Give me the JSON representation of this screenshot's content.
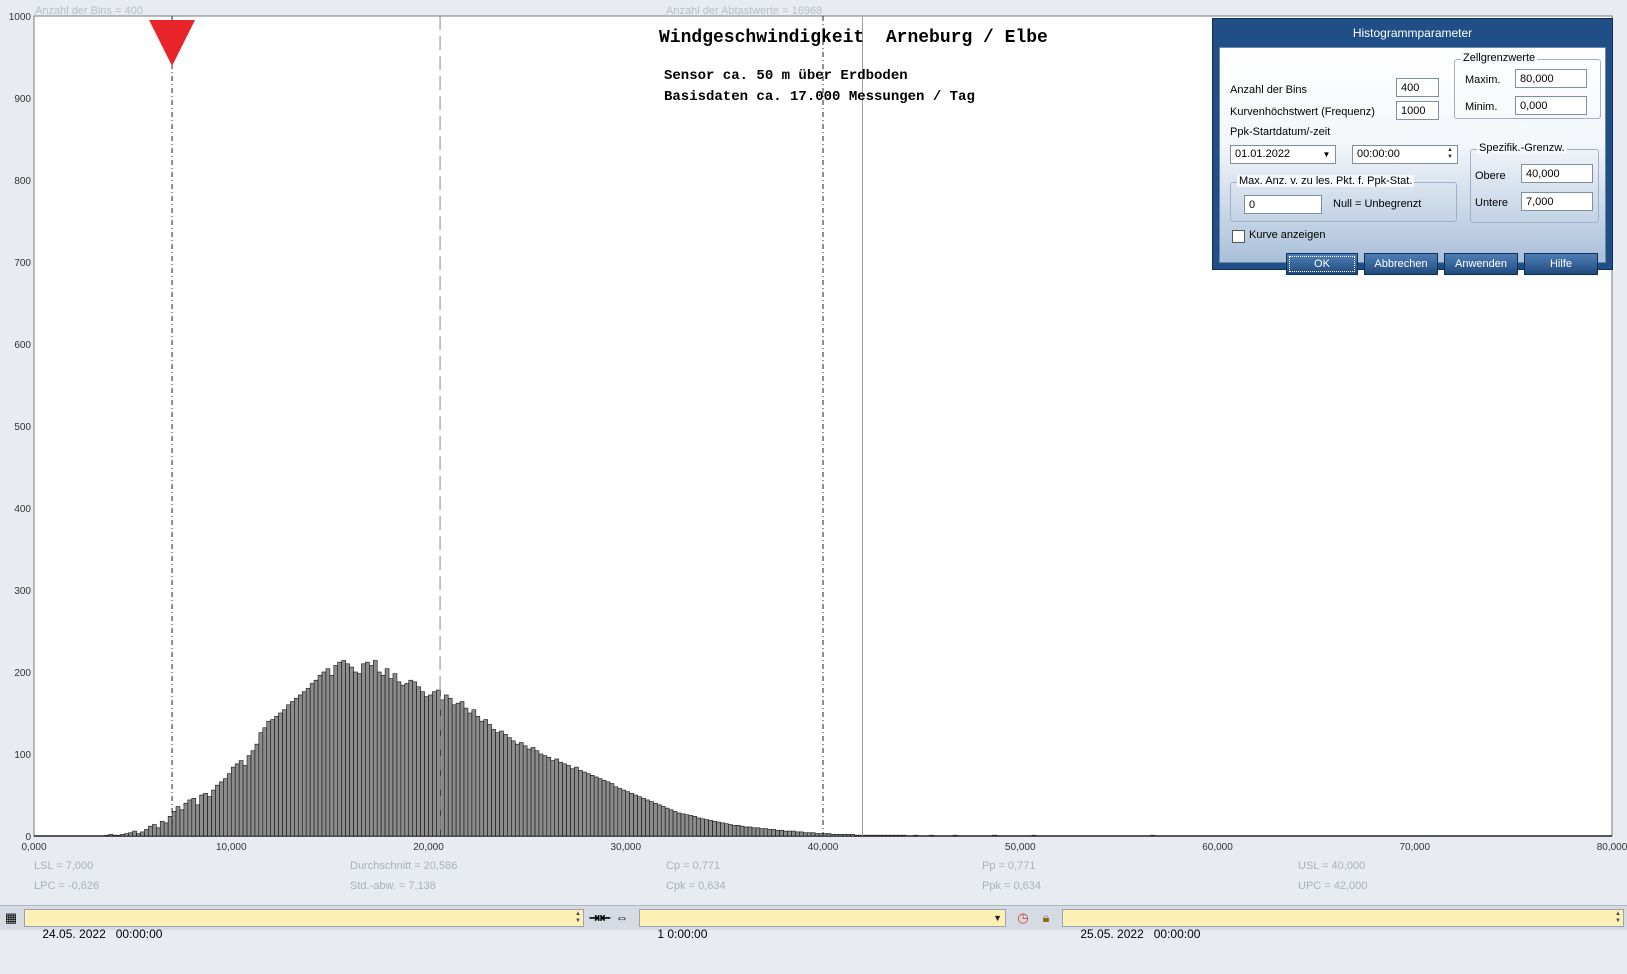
{
  "header": {
    "bins_text": "Anzahl der Bins =   400",
    "samples_text": "Anzahl der Abtastwerte = 16968"
  },
  "chart_titles": {
    "line1": "Windgeschwindigkeit  Arneburg / Elbe",
    "line2": "Sensor ca. 50 m über Erdboden",
    "line3": "Basisdaten ca. 17.000 Messungen / Tag"
  },
  "stats": {
    "lsl": "LSL = 7,000",
    "lpc": "LPC = -0,626",
    "mean": "Durchschnitt  = 20,586",
    "std": "Std.-abw. = 7,138",
    "cp": "Cp  = 0,771",
    "cpk": "Cpk = 0,634",
    "pp": "Pp  = 0,771",
    "ppk": "Ppk = 0,634",
    "usl": "USL = 40,000",
    "upc": "UPC = 42,000"
  },
  "chart_data": {
    "type": "bar",
    "xlim": [
      0,
      80
    ],
    "ylim": [
      0,
      1000
    ],
    "x_ticks": [
      {
        "v": 0,
        "label": "0,000"
      },
      {
        "v": 10,
        "label": "10,000"
      },
      {
        "v": 20,
        "label": "20,000"
      },
      {
        "v": 30,
        "label": "30,000"
      },
      {
        "v": 40,
        "label": "40,000"
      },
      {
        "v": 50,
        "label": "50,000"
      },
      {
        "v": 60,
        "label": "60,000"
      },
      {
        "v": 70,
        "label": "70,000"
      },
      {
        "v": 80,
        "label": "80,000"
      }
    ],
    "y_ticks": [
      {
        "v": 0,
        "label": "0"
      },
      {
        "v": 100,
        "label": "100"
      },
      {
        "v": 200,
        "label": "200"
      },
      {
        "v": 300,
        "label": "300"
      },
      {
        "v": 400,
        "label": "400"
      },
      {
        "v": 500,
        "label": "500"
      },
      {
        "v": 600,
        "label": "600"
      },
      {
        "v": 700,
        "label": "700"
      },
      {
        "v": 800,
        "label": "800"
      },
      {
        "v": 900,
        "label": "900"
      },
      {
        "v": 1000,
        "label": "1000"
      }
    ],
    "bin_width": 0.2,
    "bin_start": 0,
    "values": [
      0,
      0,
      0,
      0,
      0,
      0,
      0,
      0,
      0,
      0,
      0,
      0,
      0,
      0,
      0,
      0,
      0,
      0,
      1,
      2,
      1,
      1,
      2,
      3,
      4,
      6,
      3,
      5,
      8,
      12,
      14,
      10,
      18,
      16,
      24,
      30,
      36,
      32,
      40,
      44,
      46,
      38,
      50,
      52,
      48,
      56,
      62,
      66,
      70,
      76,
      84,
      88,
      92,
      86,
      98,
      104,
      112,
      126,
      132,
      140,
      142,
      146,
      150,
      154,
      160,
      164,
      168,
      172,
      176,
      180,
      186,
      190,
      196,
      200,
      204,
      196,
      208,
      212,
      214,
      210,
      206,
      200,
      198,
      210,
      212,
      208,
      214,
      200,
      196,
      204,
      192,
      198,
      188,
      184,
      186,
      190,
      188,
      182,
      176,
      170,
      172,
      176,
      178,
      166,
      172,
      168,
      160,
      162,
      164,
      156,
      150,
      154,
      146,
      140,
      142,
      136,
      130,
      126,
      128,
      124,
      120,
      116,
      112,
      114,
      110,
      106,
      108,
      104,
      100,
      98,
      96,
      92,
      94,
      90,
      88,
      86,
      82,
      84,
      80,
      78,
      76,
      74,
      72,
      70,
      68,
      66,
      64,
      60,
      58,
      56,
      54,
      52,
      50,
      48,
      46,
      44,
      42,
      40,
      38,
      36,
      34,
      32,
      30,
      28,
      27,
      26,
      25,
      24,
      22,
      21,
      20,
      19,
      18,
      17,
      16,
      15,
      14,
      13,
      13,
      12,
      11,
      11,
      10,
      10,
      9,
      9,
      8,
      8,
      7,
      7,
      6,
      6,
      6,
      5,
      5,
      4,
      4,
      4,
      3,
      3,
      3,
      3,
      2,
      2,
      2,
      2,
      2,
      2,
      1,
      1,
      1,
      1,
      1,
      1,
      1,
      1,
      1,
      1,
      1,
      1,
      1,
      0,
      0,
      1,
      0,
      0,
      0,
      1,
      0,
      0,
      0,
      0,
      0,
      1,
      0,
      0,
      0,
      0,
      0,
      0,
      0,
      0,
      0,
      1,
      0,
      0,
      0,
      0,
      0,
      0,
      0,
      0,
      0,
      1,
      0,
      0,
      0,
      0,
      0,
      0,
      0,
      0,
      0,
      0,
      0,
      0,
      0,
      0,
      0,
      0,
      0,
      0,
      0,
      0,
      0,
      0,
      0,
      0,
      0,
      0,
      0,
      0,
      0,
      1,
      0,
      0,
      0,
      0,
      0,
      0,
      0,
      0,
      0,
      0,
      0,
      0,
      0,
      0,
      0,
      0,
      0,
      0,
      0,
      0,
      0,
      0,
      0,
      0,
      0,
      0,
      0,
      0,
      0,
      0,
      0,
      0,
      0,
      0,
      0,
      0,
      0,
      0,
      0,
      0,
      0,
      0,
      0,
      0,
      0,
      0,
      0,
      0,
      0,
      0,
      0,
      0,
      0,
      0,
      0,
      0,
      0,
      0,
      0,
      0,
      0,
      0,
      0,
      0,
      0,
      0,
      0,
      0,
      0,
      0,
      0,
      0,
      0,
      0,
      0,
      0,
      0,
      0,
      0,
      0,
      0,
      0,
      0,
      0,
      0,
      0,
      0,
      0,
      0,
      0,
      0,
      0,
      0,
      0,
      0,
      0,
      0,
      0,
      0,
      0,
      0,
      0,
      0,
      0,
      0,
      0,
      0,
      0,
      0,
      0,
      0,
      0,
      0,
      0,
      0,
      0,
      0,
      0,
      0,
      0,
      0,
      0,
      0,
      0,
      0,
      0,
      0,
      0,
      0,
      0,
      0,
      0,
      0,
      0
    ],
    "reference_lines": [
      {
        "name": "lsl",
        "x": 7.0,
        "style": "dash-dot"
      },
      {
        "name": "mean",
        "x": 20.586,
        "style": "long-dash"
      },
      {
        "name": "usl",
        "x": 40.0,
        "style": "dash-dot"
      },
      {
        "name": "upc",
        "x": 42.0,
        "style": "solid"
      }
    ],
    "marker_x": 7.0,
    "grid": false
  },
  "dialog": {
    "title": "Histogrammparameter",
    "bins_label": "Anzahl der Bins",
    "bins_value": "400",
    "curve_max_label": "Kurvenhöchstwert (Frequenz)",
    "curve_max_value": "1000",
    "ppk_start_label": "Ppk-Startdatum/-zeit",
    "ppk_date": "01.01.2022",
    "ppk_time": "00:00:00",
    "cell_group_title": "Zellgrenzwerte",
    "max_label": "Maxim.",
    "max_value": "80,000",
    "min_label": "Minim.",
    "min_value": "0,000",
    "maxpts_group_title": "Max. Anz. v. zu les. Pkt. f. Ppk-Stat.",
    "maxpts_value": "0",
    "null_note": "Null = Unbegrenzt",
    "spec_group_title": "Spezifik.-Grenzw.",
    "upper_label": "Obere",
    "upper_value": "40,000",
    "lower_label": "Untere",
    "lower_value": "7,000",
    "show_curve_label": "Kurve anzeigen",
    "ok_label": "OK",
    "cancel_label": "Abbrechen",
    "apply_label": "Anwenden",
    "help_label": "Hilfe"
  },
  "bottombar": {
    "start_datetime": "24.05. 2022   00:00:00",
    "span": "1 0:00:00",
    "end_datetime": "25.05. 2022   00:00:00"
  },
  "colors": {
    "bar_fill": "#8c8c8c",
    "marker": "#e8232a",
    "dialog_frame": "#1f4f86",
    "field_yellow": "#fdf0b4"
  }
}
